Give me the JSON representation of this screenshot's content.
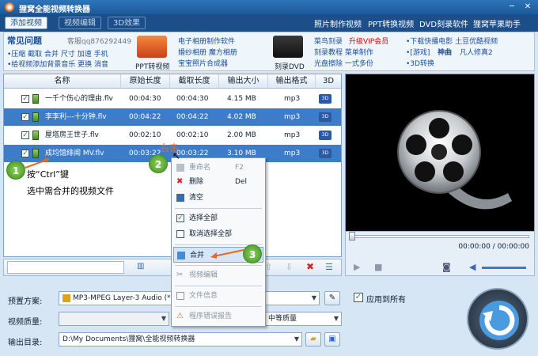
{
  "window": {
    "title": "狸窝全能视频转换器",
    "controls": {
      "minimize": "─",
      "close": "✕"
    }
  },
  "tabs": [
    {
      "label": "添加视频"
    },
    {
      "label": "视频编辑"
    },
    {
      "label": "3D效果"
    }
  ],
  "top_links": [
    "照片制作视频",
    "PPT转换视频",
    "DVD刻录软件",
    "狸窝苹果助手"
  ],
  "ads": {
    "faq_title": "常见问题",
    "support_qq": "客服qq876292449",
    "left_links_1": "•压缩  截取  合并  尺寸  加速  手机",
    "left_links_2": "•给视频添加背景音乐  更换  消音",
    "ppt_label": "PPT转视频",
    "mid_links_1": "电子相册制作软件",
    "mid_links_2": "婚纱相册  魔方相册",
    "mid_links_3": "宝宝照片合成器",
    "dvd_label": "刻录DVD",
    "right_links_1a": "菜鸟刻录",
    "right_links_1b": "升级VIP会员",
    "right_links_2": "刻录教程  菜单制作",
    "right_links_3": "光盘擦除  一式多份",
    "far_links_1": "•下载快播电影  土豆优酷视频",
    "far_links_2a": "•[游戏]",
    "far_links_2b": "神曲",
    "far_links_2c": "凡人修真2",
    "far_links_3": "•3D转换"
  },
  "file_list": {
    "columns": [
      "名称",
      "原始长度",
      "截取长度",
      "输出大小",
      "输出格式",
      "3D"
    ],
    "rows": [
      {
        "name": "一千个伤心的理由.flv",
        "orig": "00:04:30",
        "cut": "00:04:30",
        "size": "4.15 MB",
        "format": "mp3",
        "selected": false
      },
      {
        "name": "李李利---十分钟.flv",
        "orig": "00:04:22",
        "cut": "00:04:22",
        "size": "4.02 MB",
        "format": "mp3",
        "selected": true
      },
      {
        "name": "屋塔房王世子.flv",
        "orig": "00:02:10",
        "cut": "00:02:10",
        "size": "2.00 MB",
        "format": "mp3",
        "selected": false
      },
      {
        "name": "成均馆绯闻 MV.flv",
        "orig": "00:03:22",
        "cut": "00:03:22",
        "size": "3.10 MB",
        "format": "mp3",
        "selected": true
      }
    ],
    "d3_badge": "3D"
  },
  "context_menu": {
    "rename": "重命名",
    "rename_shortcut": "F2",
    "delete": "删除",
    "delete_shortcut": "Del",
    "clear": "清空",
    "select_all": "选择全部",
    "deselect_all": "取消选择全部",
    "merge": "合并",
    "video_edit": "视频编辑",
    "file_info": "文件信息",
    "error_report": "程序错误报告"
  },
  "annotations": {
    "step1": "1",
    "step2": "2",
    "step3": "3",
    "note1_line1": "按“Ctrl”键",
    "note1_line2": "选中需合并的视频文件",
    "note2": "右击"
  },
  "player": {
    "time": "00:00:00 / 00:00:00"
  },
  "settings": {
    "preset_label": "预置方案:",
    "preset_value": "MP3-MPEG Layer-3 Audio (*",
    "quality_label": "视频质量:",
    "audio_quality_value": "中等质量",
    "output_label": "输出目录:",
    "output_value": "D:\\My Documents\\狸窝\\全能视频转换器",
    "apply_all": "应用到所有"
  },
  "colors": {
    "title_bar": "#1a5a9c",
    "selection": "#3d7cc9",
    "accent_green": "#3d8f1f"
  }
}
